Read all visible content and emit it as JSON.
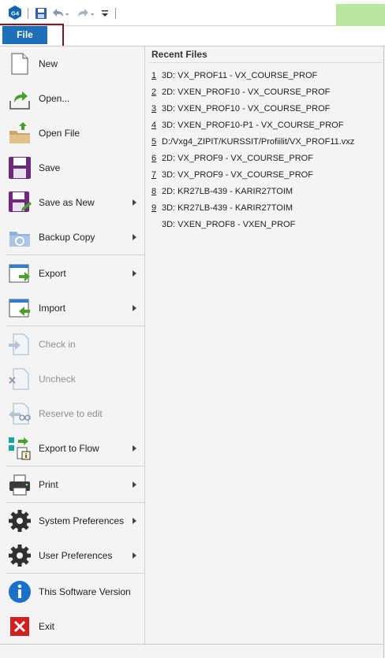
{
  "menu": {
    "file_tab": "File",
    "items": [
      {
        "label": "New",
        "icon": "new-document-icon",
        "has_submenu": false,
        "enabled": true
      },
      {
        "label": "Open...",
        "icon": "open-icon",
        "has_submenu": false,
        "enabled": true
      },
      {
        "label": "Open File",
        "icon": "open-folder-icon",
        "has_submenu": false,
        "enabled": true
      },
      {
        "label": "Save",
        "icon": "save-icon",
        "has_submenu": false,
        "enabled": true
      },
      {
        "label": "Save as New",
        "icon": "save-as-new-icon",
        "has_submenu": true,
        "enabled": true
      },
      {
        "label": "Backup Copy",
        "icon": "backup-copy-icon",
        "has_submenu": true,
        "enabled": true
      },
      {
        "label": "Export",
        "icon": "export-icon",
        "has_submenu": true,
        "enabled": true
      },
      {
        "label": "Import",
        "icon": "import-icon",
        "has_submenu": true,
        "enabled": true
      },
      {
        "label": "Check in",
        "icon": "check-in-icon",
        "has_submenu": false,
        "enabled": false
      },
      {
        "label": "Uncheck",
        "icon": "uncheck-icon",
        "has_submenu": false,
        "enabled": false
      },
      {
        "label": "Reserve to edit",
        "icon": "reserve-icon",
        "has_submenu": false,
        "enabled": false
      },
      {
        "label": "Export to Flow",
        "icon": "export-to-flow-icon",
        "has_submenu": true,
        "enabled": true
      },
      {
        "label": "Print",
        "icon": "printer-icon",
        "has_submenu": true,
        "enabled": true
      },
      {
        "label": "System Preferences",
        "icon": "gear-icon",
        "has_submenu": true,
        "enabled": true
      },
      {
        "label": "User Preferences",
        "icon": "gear-icon",
        "has_submenu": true,
        "enabled": true
      },
      {
        "label": "This Software Version",
        "icon": "info-icon",
        "has_submenu": false,
        "enabled": true
      },
      {
        "label": "Exit",
        "icon": "exit-icon",
        "has_submenu": false,
        "enabled": true
      }
    ]
  },
  "recent": {
    "title": "Recent Files",
    "files": [
      {
        "num": "1",
        "name": "3D: VX_PROF11 - VX_COURSE_PROF"
      },
      {
        "num": "2",
        "name": "2D: VXEN_PROF10 - VX_COURSE_PROF"
      },
      {
        "num": "3",
        "name": "3D: VXEN_PROF10 - VX_COURSE_PROF"
      },
      {
        "num": "4",
        "name": "3D: VXEN_PROF10-P1 - VX_COURSE_PROF"
      },
      {
        "num": "5",
        "name": "D:/Vxg4_ZIPIT/KURSSIT/Profiilit/VX_PROF11.vxz"
      },
      {
        "num": "6",
        "name": "2D: VX_PROF9 - VX_COURSE_PROF"
      },
      {
        "num": "7",
        "name": "3D: VX_PROF9 - VX_COURSE_PROF"
      },
      {
        "num": "8",
        "name": "2D: KR27LB-439 - KARIR27TOIM"
      },
      {
        "num": "9",
        "name": "3D: KR27LB-439 - KARIR27TOIM"
      },
      {
        "num": "",
        "name": "3D: VXEN_PROF8 - VXEN_PROF"
      }
    ]
  },
  "qat": {
    "app_badge": "G4"
  },
  "colors": {
    "file_tab": "#1e6fb8",
    "tab_outline": "#7a1c1c",
    "accent": "#b9e5a0"
  }
}
